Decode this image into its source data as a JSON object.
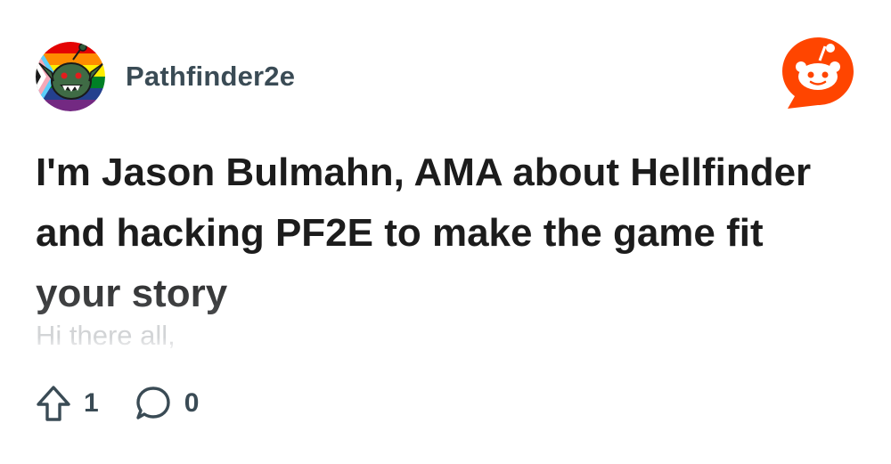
{
  "post": {
    "subreddit": "Pathfinder2e",
    "title": "I'm Jason Bulmahn, AMA about Hellfinder and hacking PF2E to make the game fit your story",
    "body_preview": "Hi there all,",
    "upvotes": "1",
    "comments": "0"
  },
  "icons": {
    "avatar": "subreddit-avatar",
    "logo": "reddit-logo-icon",
    "upvote": "upvote-arrow-icon",
    "comment": "comment-bubble-icon"
  },
  "colors": {
    "reddit_orange": "#ff4500",
    "title": "#1c1c1c",
    "meta": "#3a4b55"
  }
}
